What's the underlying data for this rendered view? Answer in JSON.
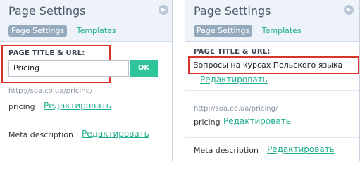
{
  "left_panel": {
    "title": "Page Settings",
    "tabs": [
      "Page Settings",
      "Templates"
    ],
    "section_label": "PAGE TITLE & URL:",
    "title_input_value": "Pricing",
    "ok_label": "OK",
    "url": "http://soa.co.ua/pricing/",
    "slug": "pricing",
    "edit_label": "Редактировать",
    "meta_label": "Meta description",
    "meta_edit_label": "Редактировать"
  },
  "right_panel": {
    "title": "Page Settings",
    "tabs": [
      "Page Settings",
      "Templates"
    ],
    "section_label": "PAGE TITLE & URL:",
    "title_value": "Вопросы на курсах Польского языка",
    "title_edit_label": "Редактировать",
    "url": "http://soa.co.ua/pricing/",
    "slug": "pricing",
    "edit_label": "Редактировать",
    "meta_label": "Meta description",
    "meta_edit_label": "Редактировать"
  },
  "colors": {
    "accent": "#1faf8c",
    "ok_button": "#2fc59a",
    "highlight": "#d6352a",
    "header_bg": "#eef3fa",
    "active_tab": "#96aabd"
  },
  "icons": {
    "collapse": "chevron-right-icon"
  }
}
